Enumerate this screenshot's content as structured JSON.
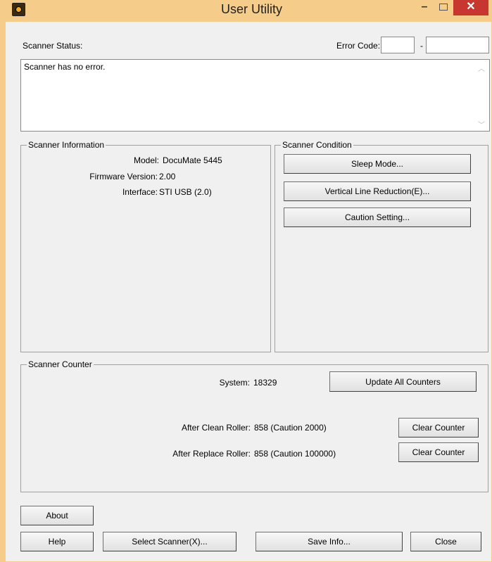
{
  "window": {
    "title": "User Utility",
    "minimize": "–",
    "close": "✕"
  },
  "status": {
    "label": "Scanner Status:",
    "error_code_label": "Error Code:",
    "error_code_1": "",
    "error_code_2": "",
    "error_separator": "-",
    "message": "Scanner has no error."
  },
  "info": {
    "title": "Scanner Information",
    "model_label": "Model:",
    "model_value": "DocuMate 5445",
    "firmware_label": "Firmware Version:",
    "firmware_value": "2.00",
    "interface_label": "Interface:",
    "interface_value": "STI USB (2.0)"
  },
  "condition": {
    "title": "Scanner Condition",
    "sleep_mode": "Sleep Mode...",
    "vertical_line": "Vertical Line Reduction(E)...",
    "caution_setting": "Caution Setting..."
  },
  "counter": {
    "title": "Scanner Counter",
    "system_label": "System:",
    "system_value": "18329",
    "update_all": "Update All Counters",
    "clean_label": "After Clean Roller:",
    "clean_value": "858 (Caution 2000)",
    "replace_label": "After Replace Roller:",
    "replace_value": "858 (Caution 100000)",
    "clear_counter": "Clear Counter"
  },
  "footer": {
    "about": "About",
    "help": "Help",
    "select_scanner": "Select Scanner(X)...",
    "save_info": "Save Info...",
    "close": "Close"
  }
}
